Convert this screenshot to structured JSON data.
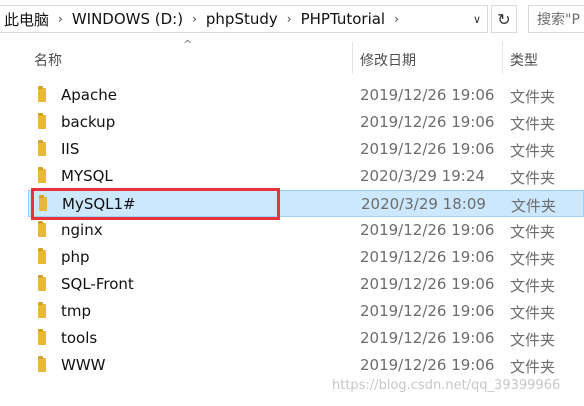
{
  "address_bar": {
    "crumbs": [
      "此电脑",
      "WINDOWS (D:)",
      "phpStudy",
      "PHPTutorial"
    ],
    "separator": "›",
    "dropdown_glyph": "∨",
    "refresh_glyph": "↻",
    "search_placeholder": "搜索\"P"
  },
  "columns": {
    "name": "名称",
    "date": "修改日期",
    "type": "类型",
    "sort_glyph": "^"
  },
  "files": [
    {
      "name": "Apache",
      "date": "2019/12/26 19:06",
      "type": "文件夹"
    },
    {
      "name": "backup",
      "date": "2019/12/26 19:06",
      "type": "文件夹"
    },
    {
      "name": "IIS",
      "date": "2019/12/26 19:06",
      "type": "文件夹"
    },
    {
      "name": "MYSQL",
      "date": "2020/3/29 19:24",
      "type": "文件夹"
    },
    {
      "name": "MySQL1#",
      "date": "2020/3/29 18:09",
      "type": "文件夹",
      "selected": true
    },
    {
      "name": "nginx",
      "date": "2019/12/26 19:06",
      "type": "文件夹"
    },
    {
      "name": "php",
      "date": "2019/12/26 19:06",
      "type": "文件夹"
    },
    {
      "name": "SQL-Front",
      "date": "2019/12/26 19:06",
      "type": "文件夹"
    },
    {
      "name": "tmp",
      "date": "2019/12/26 19:06",
      "type": "文件夹"
    },
    {
      "name": "tools",
      "date": "2019/12/26 19:06",
      "type": "文件夹"
    },
    {
      "name": "WWW",
      "date": "2019/12/26 19:06",
      "type": "文件夹"
    }
  ],
  "watermark": "https://blog.csdn.net/qq_39399966",
  "colors": {
    "selection_bg": "#cce8ff",
    "highlight_border": "#e8333a",
    "folder": "#e8b83a"
  }
}
